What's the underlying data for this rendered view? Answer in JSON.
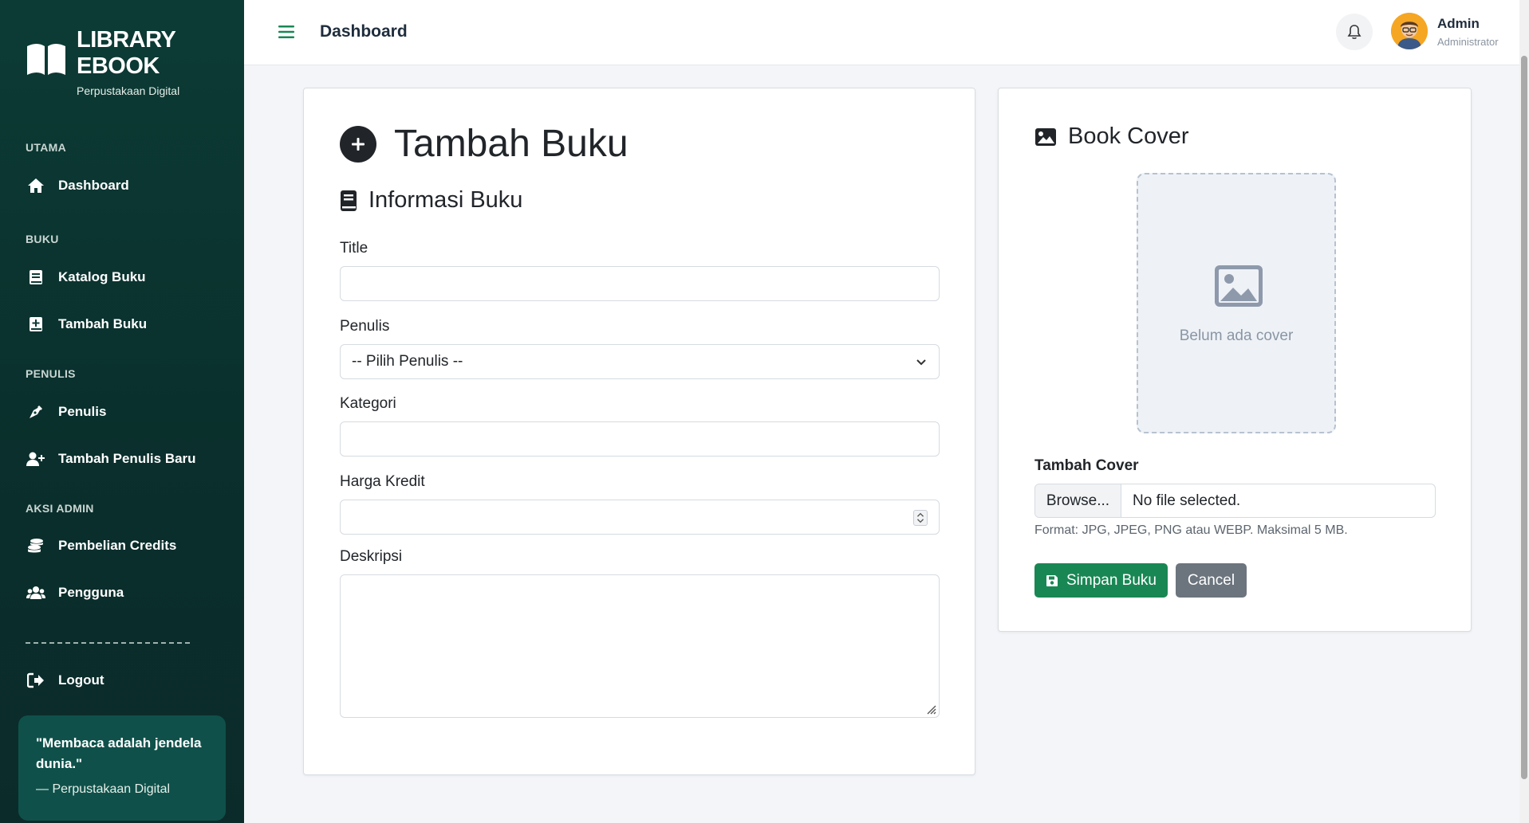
{
  "brand": {
    "title_line1": "LIBRARY",
    "title_line2": "EBOOK",
    "subtitle": "Perpustakaan Digital"
  },
  "sidebar": {
    "sections": [
      "UTAMA",
      "BUKU",
      "PENULIS",
      "AKSI ADMIN"
    ],
    "items": [
      {
        "label": "Dashboard",
        "icon": "home-icon"
      },
      {
        "label": "Katalog Buku",
        "icon": "book-icon"
      },
      {
        "label": "Tambah Buku",
        "icon": "book-plus-icon"
      },
      {
        "label": "Penulis",
        "icon": "pen-nib-icon"
      },
      {
        "label": "Tambah Penulis Baru",
        "icon": "user-plus-icon"
      },
      {
        "label": "Pembelian Credits",
        "icon": "coins-icon"
      },
      {
        "label": "Pengguna",
        "icon": "users-icon"
      },
      {
        "label": "Logout",
        "icon": "logout-icon"
      }
    ],
    "quote": {
      "text": "\"Membaca adalah jendela dunia.\"",
      "source": "— Perpustakaan Digital"
    }
  },
  "topbar": {
    "title": "Dashboard",
    "user_name": "Admin",
    "user_role": "Administrator"
  },
  "form": {
    "page_title": "Tambah Buku",
    "section_title": "Informasi Buku",
    "fields": {
      "title_label": "Title",
      "title_value": "",
      "penulis_label": "Penulis",
      "penulis_value": "-- Pilih Penulis --",
      "kategori_label": "Kategori",
      "kategori_value": "",
      "harga_label": "Harga Kredit",
      "harga_value": "",
      "deskripsi_label": "Deskripsi",
      "deskripsi_value": ""
    }
  },
  "cover": {
    "title": "Book Cover",
    "placeholder": "Belum ada cover",
    "label": "Tambah Cover",
    "browse_label": "Browse...",
    "file_status": "No file selected.",
    "help": "Format: JPG, JPEG, PNG atau WEBP. Maksimal 5 MB.",
    "save_label": "Simpan Buku",
    "cancel_label": "Cancel"
  },
  "colors": {
    "sidebar_bg": "#0c3b35",
    "accent": "#198754",
    "secondary": "#6c757d",
    "hamburger": "#198754"
  }
}
